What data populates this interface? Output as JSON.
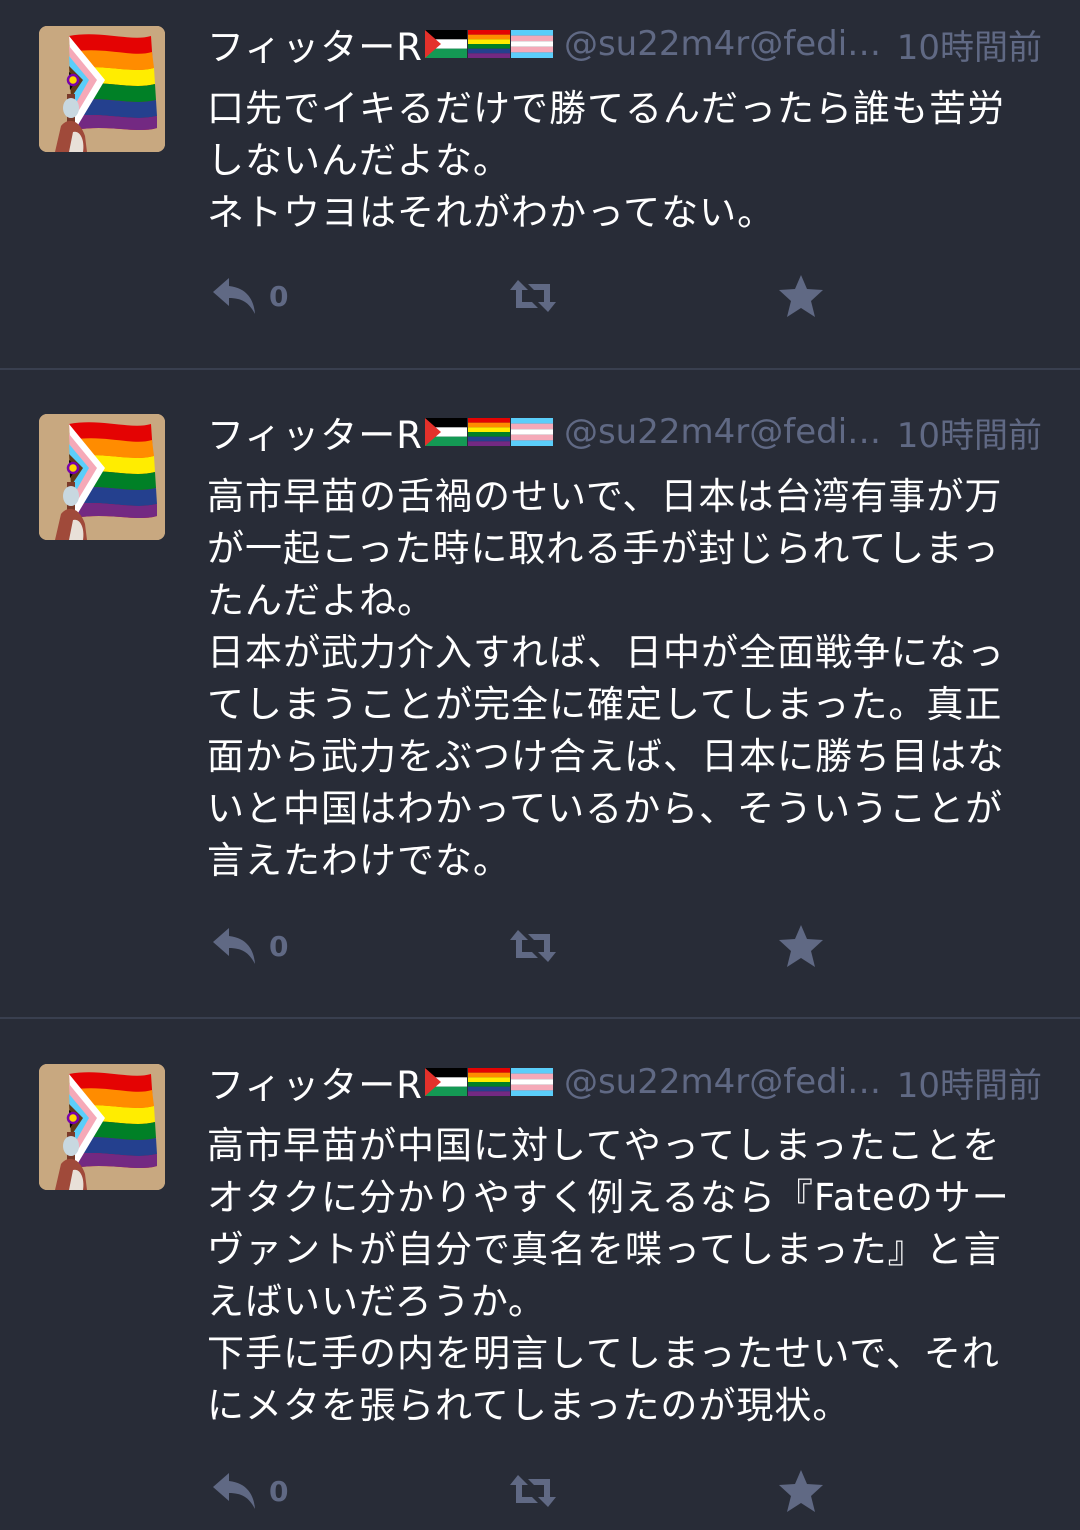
{
  "colors": {
    "background": "#282c37",
    "divider": "#393f4f",
    "muted": "#606984",
    "text": "#ffffff"
  },
  "statuses": [
    {
      "display_name": "フィッターR",
      "flags": [
        "palestine-flag",
        "rainbow-flag",
        "transgender-flag"
      ],
      "acct": "@su22m4r@fedib...",
      "time": "10時間前",
      "paragraphs": [
        [
          "口先でイキるだけで勝てるんだったら誰も苦労",
          "しないんだよな。"
        ],
        [
          "ネトウヨはそれがわかってない。"
        ]
      ],
      "reply_count": "0"
    },
    {
      "display_name": "フィッターR",
      "flags": [
        "palestine-flag",
        "rainbow-flag",
        "transgender-flag"
      ],
      "acct": "@su22m4r@fedib...",
      "time": "10時間前",
      "paragraphs": [
        [
          "高市早苗の舌禍のせいで、日本は台湾有事が万",
          "が一起こった時に取れる手が封じられてしまっ",
          "たんだよね。"
        ],
        [
          "日本が武力介入すれば、日中が全面戦争になっ",
          "てしまうことが完全に確定してしまった。真正",
          "面から武力をぶつけ合えば、日本に勝ち目はな",
          "いと中国はわかっているから、そういうことが",
          "言えたわけでな。"
        ]
      ],
      "reply_count": "0"
    },
    {
      "display_name": "フィッターR",
      "flags": [
        "palestine-flag",
        "rainbow-flag",
        "transgender-flag"
      ],
      "acct": "@su22m4r@fedib...",
      "time": "10時間前",
      "paragraphs": [
        [
          "高市早苗が中国に対してやってしまったことを",
          "オタクに分かりやすく例えるなら『Fateのサー",
          "ヴァントが自分で真名を喋ってしまった』と言",
          "えばいいだろうか。"
        ],
        [
          "下手に手の内を明言してしまったせいで、それ",
          "にメタを張られてしまったのが現状。"
        ]
      ],
      "reply_count": "0"
    }
  ]
}
